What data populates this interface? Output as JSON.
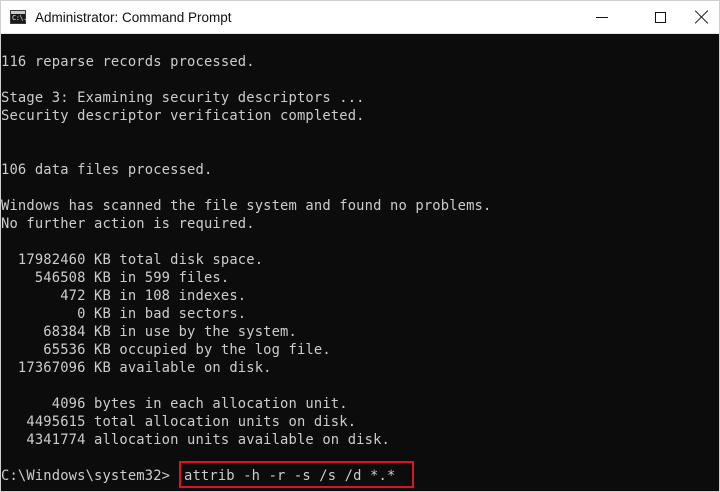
{
  "window": {
    "title": "Administrator: Command Prompt",
    "icon": "cmd-icon",
    "icon_glyph": "C:\\."
  },
  "controls": {
    "minimize_icon": "minimize-icon",
    "maximize_icon": "maximize-icon",
    "close_icon": "close-icon"
  },
  "console": {
    "lines": [
      "116 reparse records processed.",
      "",
      "Stage 3: Examining security descriptors ...",
      "Security descriptor verification completed.",
      "",
      "",
      "106 data files processed.",
      "",
      "Windows has scanned the file system and found no problems.",
      "No further action is required.",
      "",
      "  17982460 KB total disk space.",
      "    546508 KB in 599 files.",
      "       472 KB in 108 indexes.",
      "         0 KB in bad sectors.",
      "     68384 KB in use by the system.",
      "     65536 KB occupied by the log file.",
      "  17367096 KB available on disk.",
      "",
      "      4096 bytes in each allocation unit.",
      "   4495615 total allocation units on disk.",
      "   4341774 allocation units available on disk."
    ],
    "prompt": "C:\\Windows\\system32>",
    "command": "attrib -h -r -s /s /d *.*"
  },
  "colors": {
    "console_bg": "#0c0c0c",
    "console_text": "#cccccc",
    "highlight_border": "#e0131a",
    "titlebar_bg": "#ffffff"
  }
}
